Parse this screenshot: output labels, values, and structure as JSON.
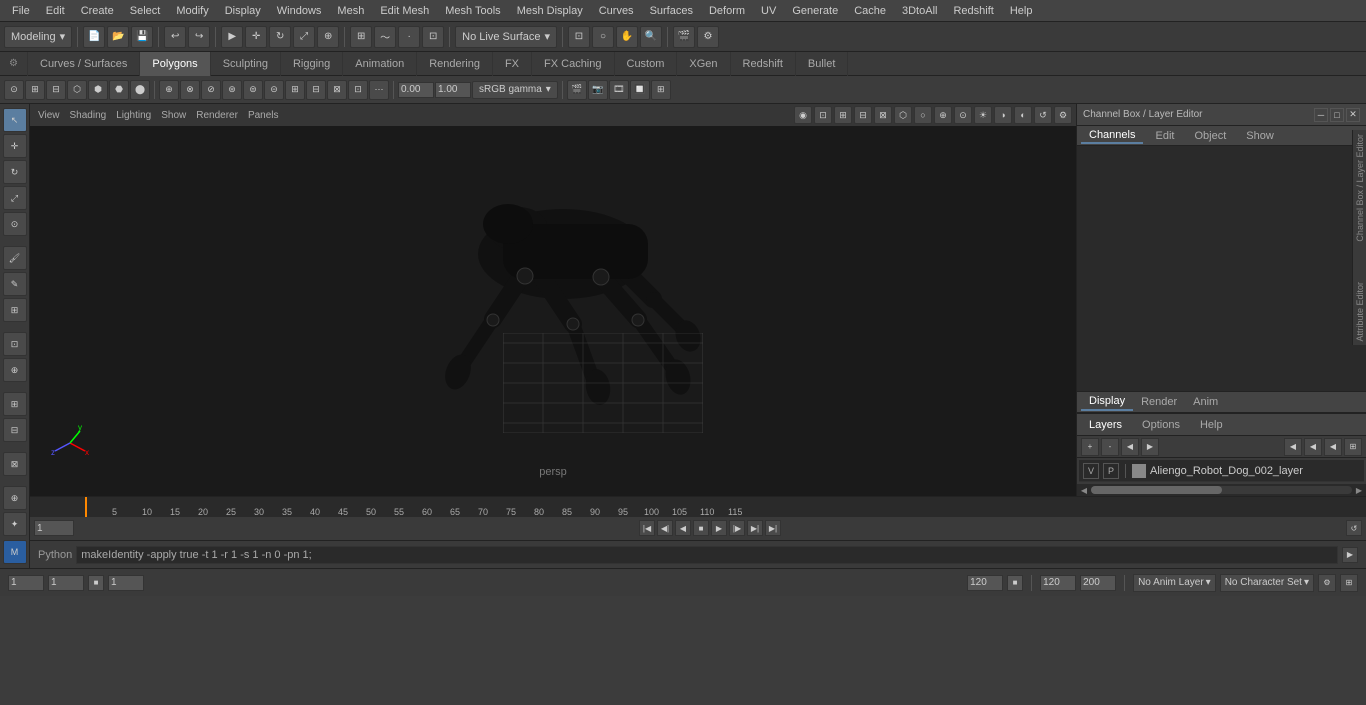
{
  "menu": {
    "items": [
      {
        "label": "File",
        "id": "file"
      },
      {
        "label": "Edit",
        "id": "edit"
      },
      {
        "label": "Create",
        "id": "create"
      },
      {
        "label": "Select",
        "id": "select"
      },
      {
        "label": "Modify",
        "id": "modify"
      },
      {
        "label": "Display",
        "id": "display"
      },
      {
        "label": "Windows",
        "id": "windows"
      },
      {
        "label": "Mesh",
        "id": "mesh"
      },
      {
        "label": "Edit Mesh",
        "id": "edit-mesh"
      },
      {
        "label": "Mesh Tools",
        "id": "mesh-tools"
      },
      {
        "label": "Mesh Display",
        "id": "mesh-display"
      },
      {
        "label": "Curves",
        "id": "curves"
      },
      {
        "label": "Surfaces",
        "id": "surfaces"
      },
      {
        "label": "Deform",
        "id": "deform"
      },
      {
        "label": "UV",
        "id": "uv"
      },
      {
        "label": "Generate",
        "id": "generate"
      },
      {
        "label": "Cache",
        "id": "cache"
      },
      {
        "label": "3DtoAll",
        "id": "3dtoall"
      },
      {
        "label": "Redshift",
        "id": "redshift"
      },
      {
        "label": "Help",
        "id": "help"
      }
    ]
  },
  "toolbar1": {
    "mode_label": "Modeling",
    "undo_label": "↩",
    "redo_label": "↪"
  },
  "mode_tabs": {
    "items": [
      {
        "label": "Curves / Surfaces",
        "active": false
      },
      {
        "label": "Polygons",
        "active": true
      },
      {
        "label": "Sculpting",
        "active": false
      },
      {
        "label": "Rigging",
        "active": false
      },
      {
        "label": "Animation",
        "active": false
      },
      {
        "label": "Rendering",
        "active": false
      },
      {
        "label": "FX",
        "active": false
      },
      {
        "label": "FX Caching",
        "active": false
      },
      {
        "label": "Custom",
        "active": false
      },
      {
        "label": "XGen",
        "active": false
      },
      {
        "label": "Redshift",
        "active": false
      },
      {
        "label": "Bullet",
        "active": false
      }
    ]
  },
  "viewport": {
    "label": "persp",
    "camera_menu_items": [
      "View",
      "Shading",
      "Lighting",
      "Show",
      "Renderer",
      "Panels"
    ],
    "transform_value": "0.00",
    "scale_value": "1.00",
    "color_space": "sRGB gamma"
  },
  "channel_box": {
    "title": "Channel Box / Layer Editor",
    "tabs": [
      {
        "label": "Channels",
        "active": true
      },
      {
        "label": "Edit",
        "active": false
      },
      {
        "label": "Object",
        "active": false
      },
      {
        "label": "Show",
        "active": false
      }
    ],
    "display_tab": {
      "label": "Display",
      "active": true
    },
    "render_tab": {
      "label": "Render",
      "active": false
    },
    "anim_tab": {
      "label": "Anim",
      "active": false
    }
  },
  "layers": {
    "header_label": "Layers",
    "tabs": [
      {
        "label": "Display",
        "active": true
      },
      {
        "label": "Render",
        "active": false
      },
      {
        "label": "Anim",
        "active": false
      }
    ],
    "menu_items": [
      {
        "label": "Layers"
      },
      {
        "label": "Options"
      },
      {
        "label": "Help"
      }
    ],
    "list": [
      {
        "v": "V",
        "p": "P",
        "color": "#888888",
        "name": "Aliengo_Robot_Dog_002_layer"
      }
    ]
  },
  "timeline": {
    "ticks": [
      "5",
      "10",
      "15",
      "20",
      "25",
      "30",
      "35",
      "40",
      "45",
      "50",
      "55",
      "60",
      "65",
      "70",
      "75",
      "80",
      "85",
      "90",
      "95",
      "100",
      "105",
      "110",
      "115"
    ],
    "start_frame": "1",
    "end_frame": "120",
    "current_frame": "1",
    "playback_start": "1",
    "playback_end": "120",
    "total_frames": "200"
  },
  "status_bar": {
    "label": "Python",
    "command": "makeIdentity -apply true -t 1 -r 1 -s 1 -n 0 -pn 1;"
  },
  "bottom_bar": {
    "field1": "1",
    "field2": "1",
    "field3": "1",
    "end_frame": "120",
    "anim_layer_label": "No Anim Layer",
    "char_set_label": "No Character Set"
  },
  "vertical_tabs": {
    "channel_box_label": "Channel Box / Layer Editor",
    "attribute_editor_label": "Attribute Editor"
  },
  "icons": {
    "gear": "⚙",
    "arrow_left": "◀",
    "arrow_right": "▶",
    "arrow_up": "▲",
    "arrow_down": "▼",
    "play": "▶",
    "stop": "■",
    "rewind": "◀◀",
    "forward": "▶▶",
    "step_back": "◀",
    "step_forward": "▶",
    "close": "✕",
    "minimize": "─",
    "maximize": "□"
  }
}
